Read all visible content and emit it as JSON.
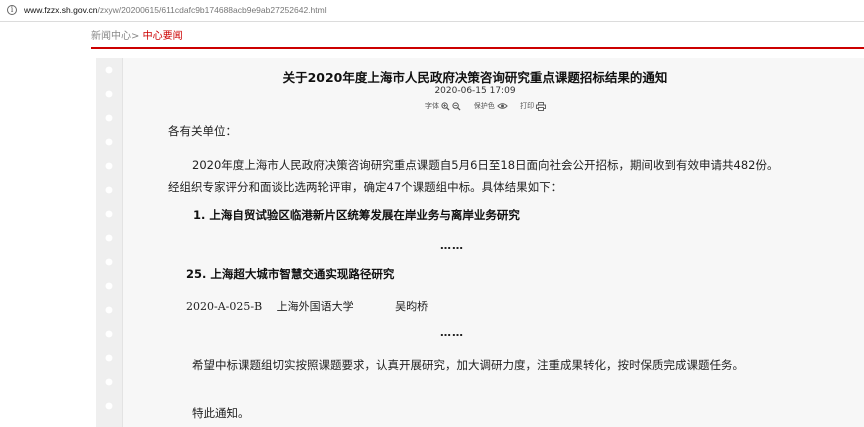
{
  "address_bar": {
    "host": "www.fzzx.sh.gov.cn",
    "path": "/zxyw/20200615/611cdafc9b174688acb9e9ab27252642.html"
  },
  "breadcrumb": {
    "home": "新闻中心>",
    "current": "中心要闻"
  },
  "article": {
    "title": "关于2020年度上海市人民政府决策咨询研究重点课题招标结果的通知",
    "date": "2020-06-15 17:09",
    "tools": {
      "font_size": "字体",
      "eye_care": "保护色",
      "print": "打印"
    },
    "salutation": "各有关单位：",
    "intro": "2020年度上海市人民政府决策咨询研究重点课题自5月6日至18日面向社会公开招标，期间收到有效申请共482份。经组织专家评分和面谈比选两轮评审，确定47个课题组中标。具体结果如下：",
    "topic_1": "1. 上海自贸试验区临港新片区统筹发展在岸业务与离岸业务研究",
    "ellipsis_1": "……",
    "topic_25": "25. 上海超大城市智慧交通实现路径研究",
    "result_row": {
      "code": "2020-A-025-B",
      "institution": "上海外国语大学",
      "person": "吴昀桥"
    },
    "ellipsis_2": "……",
    "closing": "希望中标课题组切实按照课题要求，认真开展研究，加大调研力度，注重成果转化，按时保质完成课题任务。",
    "notice": "特此通知。"
  },
  "colors": {
    "accent": "#cc0000",
    "paper": "#f7f7f7"
  },
  "icons": [
    "info-icon",
    "zoom-in-icon",
    "zoom-out-icon",
    "eye-icon",
    "printer-icon"
  ]
}
